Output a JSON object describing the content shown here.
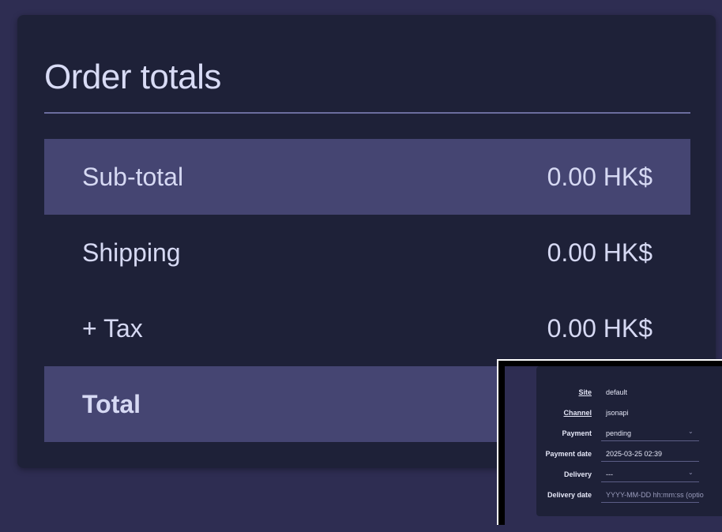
{
  "order_totals": {
    "title": "Order totals",
    "rows": [
      {
        "label": "Sub-total",
        "value": "0.00 HK$"
      },
      {
        "label": "Shipping",
        "value": "0.00 HK$"
      },
      {
        "label": "+ Tax",
        "value": "0.00 HK$"
      },
      {
        "label": "Total",
        "value": ""
      }
    ]
  },
  "inset": {
    "rows": [
      {
        "label": "Site",
        "value": "default"
      },
      {
        "label": "Channel",
        "value": "jsonapi"
      },
      {
        "label": "Payment",
        "value": "pending"
      },
      {
        "label": "Payment date",
        "value": "2025-03-25 02:39"
      },
      {
        "label": "Delivery",
        "value": "---"
      },
      {
        "label": "Delivery date",
        "placeholder": "YYYY-MM-DD hh:mm:ss (optio"
      }
    ]
  },
  "colors": {
    "background": "#2e2d52",
    "card": "#1e2138",
    "highlight_row": "#454572",
    "text": "#d6d9f3"
  }
}
